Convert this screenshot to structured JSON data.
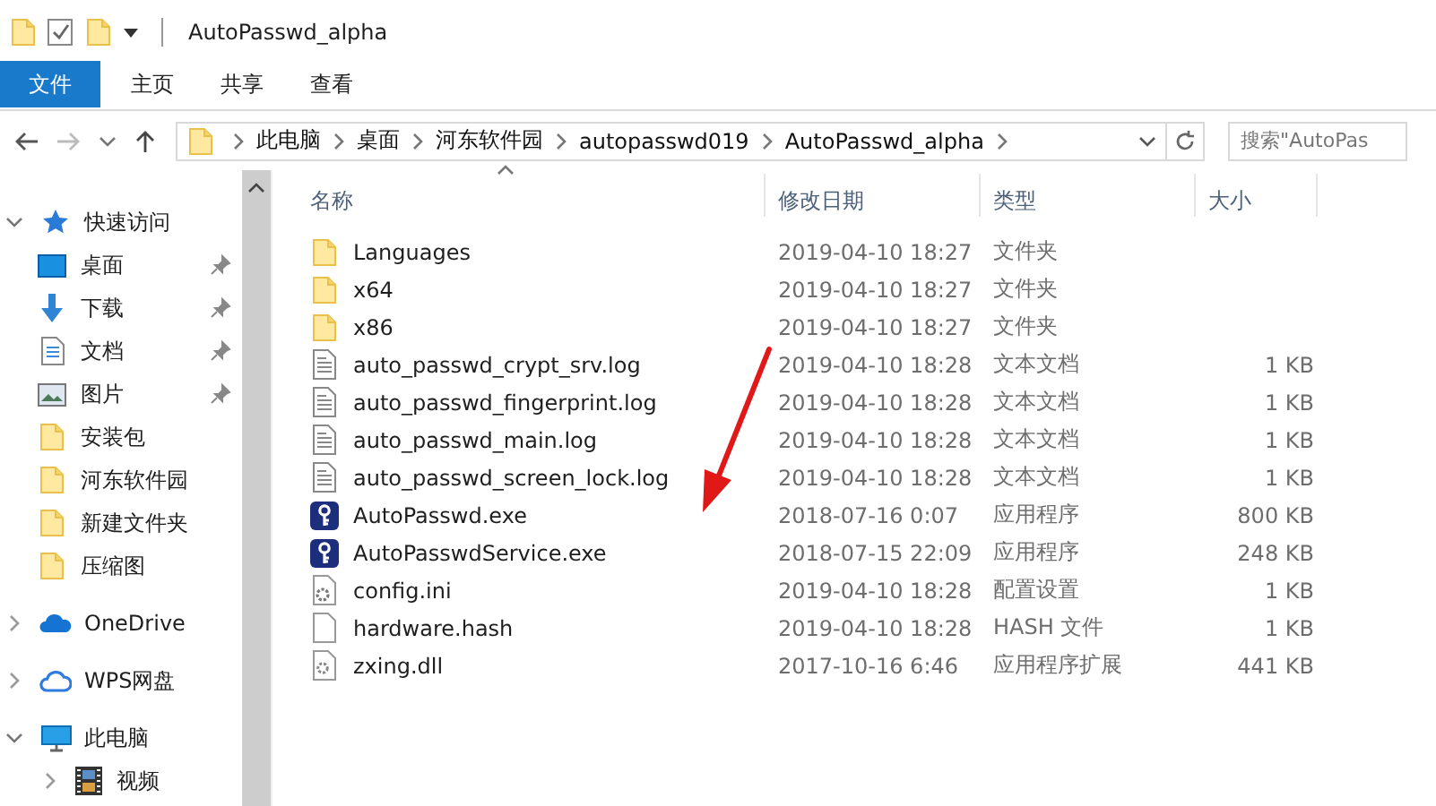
{
  "window": {
    "title": "AutoPasswd_alpha"
  },
  "ribbon": {
    "tabs": [
      {
        "label": "文件",
        "kind": "file"
      },
      {
        "label": "主页",
        "kind": "tab"
      },
      {
        "label": "共享",
        "kind": "tab"
      },
      {
        "label": "查看",
        "kind": "tab"
      }
    ]
  },
  "address_bar": {
    "path": [
      "此电脑",
      "桌面",
      "河东软件园",
      "autopasswd019",
      "AutoPasswd_alpha"
    ]
  },
  "search": {
    "placeholder": "搜索\"AutoPas"
  },
  "sidebar": {
    "items": [
      {
        "label": "快速访问",
        "kind": "star",
        "expanded": true,
        "children": [
          {
            "label": "桌面",
            "kind": "desktop",
            "pinned": true
          },
          {
            "label": "下载",
            "kind": "download",
            "pinned": true
          },
          {
            "label": "文档",
            "kind": "document",
            "pinned": true
          },
          {
            "label": "图片",
            "kind": "pictures",
            "pinned": true
          },
          {
            "label": "安装包",
            "kind": "folder",
            "pinned": false
          },
          {
            "label": "河东软件园",
            "kind": "folder",
            "pinned": false
          },
          {
            "label": "新建文件夹",
            "kind": "folder",
            "pinned": false
          },
          {
            "label": "压缩图",
            "kind": "folder",
            "pinned": false
          }
        ]
      },
      {
        "label": "OneDrive",
        "kind": "onedrive",
        "expanded": false
      },
      {
        "label": "WPS网盘",
        "kind": "wps",
        "expanded": false
      },
      {
        "label": "此电脑",
        "kind": "computer",
        "expanded": true,
        "children": [
          {
            "label": "视频",
            "kind": "video",
            "expanded": false
          }
        ]
      }
    ]
  },
  "table": {
    "columns": [
      {
        "label": "名称",
        "sorted": true
      },
      {
        "label": "修改日期",
        "sorted": false
      },
      {
        "label": "类型",
        "sorted": false
      },
      {
        "label": "大小",
        "sorted": false
      }
    ],
    "rows": [
      {
        "name": "Languages",
        "kind": "folder",
        "modified": "2019-04-10 18:27",
        "type": "文件夹"
      },
      {
        "name": "x64",
        "kind": "folder",
        "modified": "2019-04-10 18:27",
        "type": "文件夹"
      },
      {
        "name": "x86",
        "kind": "folder",
        "modified": "2019-04-10 18:27",
        "type": "文件夹"
      },
      {
        "name": "auto_passwd_crypt_srv.log",
        "kind": "text",
        "modified": "2019-04-10 18:28",
        "type": "文本文档",
        "size": "1 KB"
      },
      {
        "name": "auto_passwd_fingerprint.log",
        "kind": "text",
        "modified": "2019-04-10 18:28",
        "type": "文本文档",
        "size": "1 KB"
      },
      {
        "name": "auto_passwd_main.log",
        "kind": "text",
        "modified": "2019-04-10 18:28",
        "type": "文本文档",
        "size": "1 KB"
      },
      {
        "name": "auto_passwd_screen_lock.log",
        "kind": "text",
        "modified": "2019-04-10 18:28",
        "type": "文本文档",
        "size": "1 KB"
      },
      {
        "name": "AutoPasswd.exe",
        "kind": "exe",
        "modified": "2018-07-16 0:07",
        "type": "应用程序",
        "size": "800 KB"
      },
      {
        "name": "AutoPasswdService.exe",
        "kind": "exe",
        "modified": "2018-07-15 22:09",
        "type": "应用程序",
        "size": "248 KB"
      },
      {
        "name": "config.ini",
        "kind": "config",
        "modified": "2019-04-10 18:28",
        "type": "配置设置",
        "size": "1 KB"
      },
      {
        "name": "hardware.hash",
        "kind": "blank",
        "modified": "2019-04-10 18:28",
        "type": "HASH 文件",
        "size": "1 KB"
      },
      {
        "name": "zxing.dll",
        "kind": "dll",
        "modified": "2017-10-16 6:46",
        "type": "应用程序扩展",
        "size": "441 KB"
      }
    ]
  }
}
